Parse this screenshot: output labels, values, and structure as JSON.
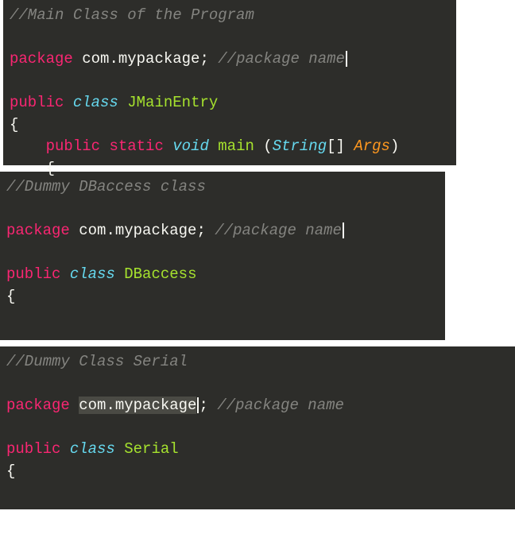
{
  "blocks": [
    {
      "line1_comment": "//Main Class of the Program",
      "line2_blank": "",
      "line3_package_kw": "package",
      "line3_pkg": "com.mypackage",
      "line3_semi": ";",
      "line3_comment": "//package name",
      "line4_blank": "",
      "line5_public": "public",
      "line5_class": "class",
      "line5_name": "JMainEntry",
      "line6_brace": "{",
      "line7_indent": "    ",
      "line7_public": "public",
      "line7_static": "static",
      "line7_void": "void",
      "line7_main": "main",
      "line7_space": " ",
      "line7_lparen": "(",
      "line7_string": "String",
      "line7_brackets": "[]",
      "line7_space2": " ",
      "line7_args": "Args",
      "line7_rparen": ")",
      "line8_indent": "    ",
      "line8_brace": "{"
    },
    {
      "line1_comment": "//Dummy DBaccess class",
      "line2_blank": "",
      "line3_package_kw": "package",
      "line3_pkg": "com.mypackage",
      "line3_semi": ";",
      "line3_comment": "//package name",
      "line4_blank": "",
      "line5_public": "public",
      "line5_class": "class",
      "line5_name": "DBaccess",
      "line6_brace": "{"
    },
    {
      "line1_comment": "//Dummy Class Serial",
      "line2_blank": "",
      "line3_package_kw": "package",
      "line3_pkg": "com.mypackage",
      "line3_semi": ";",
      "line3_comment": "//package name",
      "line4_blank": "",
      "line5_public": "public",
      "line5_class": "class",
      "line5_name": "Serial",
      "line6_brace": "{"
    }
  ]
}
